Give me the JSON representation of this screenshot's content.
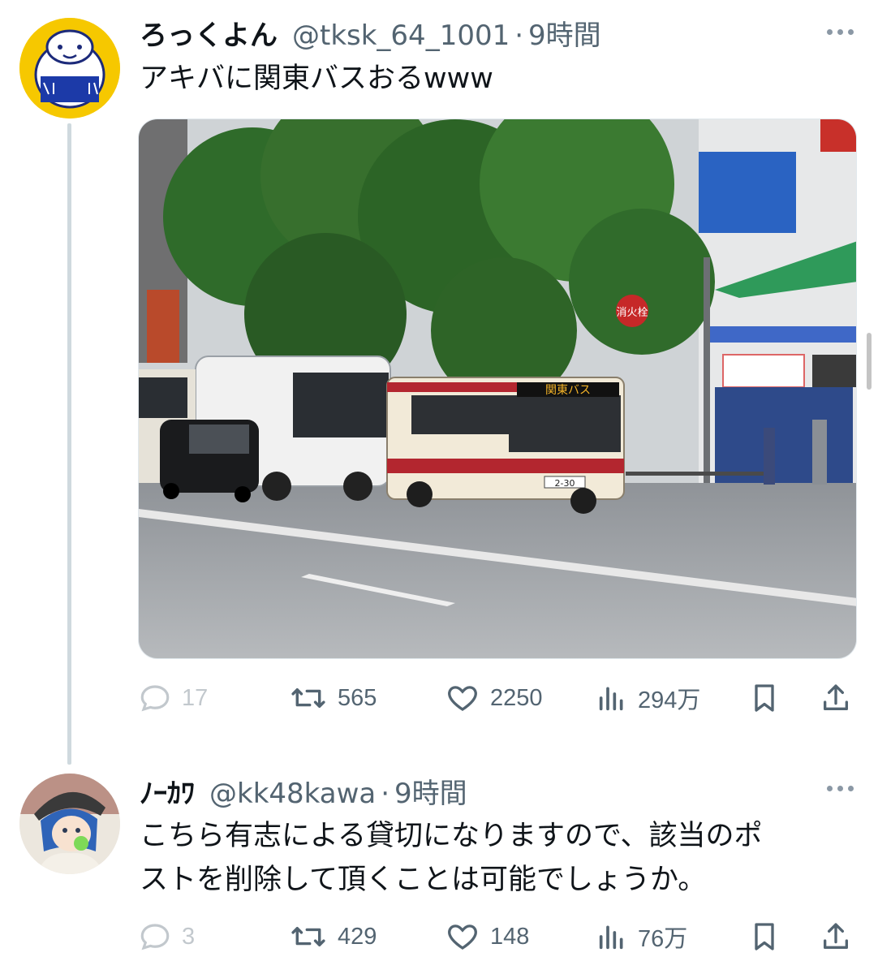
{
  "post": {
    "display_name": "ろっくよん",
    "handle": "@tksk_64_1001",
    "separator": "·",
    "time": "9時間",
    "text": "アキバに関東バスおるwww",
    "metrics": {
      "replies": "17",
      "reposts": "565",
      "likes": "2250",
      "views": "294万"
    }
  },
  "reply": {
    "display_name": "ﾉｰｶﾜ",
    "handle": "@kk48kawa",
    "separator": "·",
    "time": "9時間",
    "text_line1": "こちら有志による貸切になりますので、該当のポ",
    "text_line2": "ストを削除して頂くことは可能でしょうか。",
    "metrics": {
      "replies": "3",
      "reposts": "429",
      "likes": "148",
      "views": "76万"
    }
  },
  "photo_signs": {
    "bus_destination": "関東バス",
    "hydrant_sign": "消火栓",
    "bus_number": "2-30"
  },
  "colors": {
    "text_primary": "#0f1419",
    "text_secondary": "#536471",
    "thread_line": "#cfd9de",
    "bus_red": "#b3262f"
  }
}
